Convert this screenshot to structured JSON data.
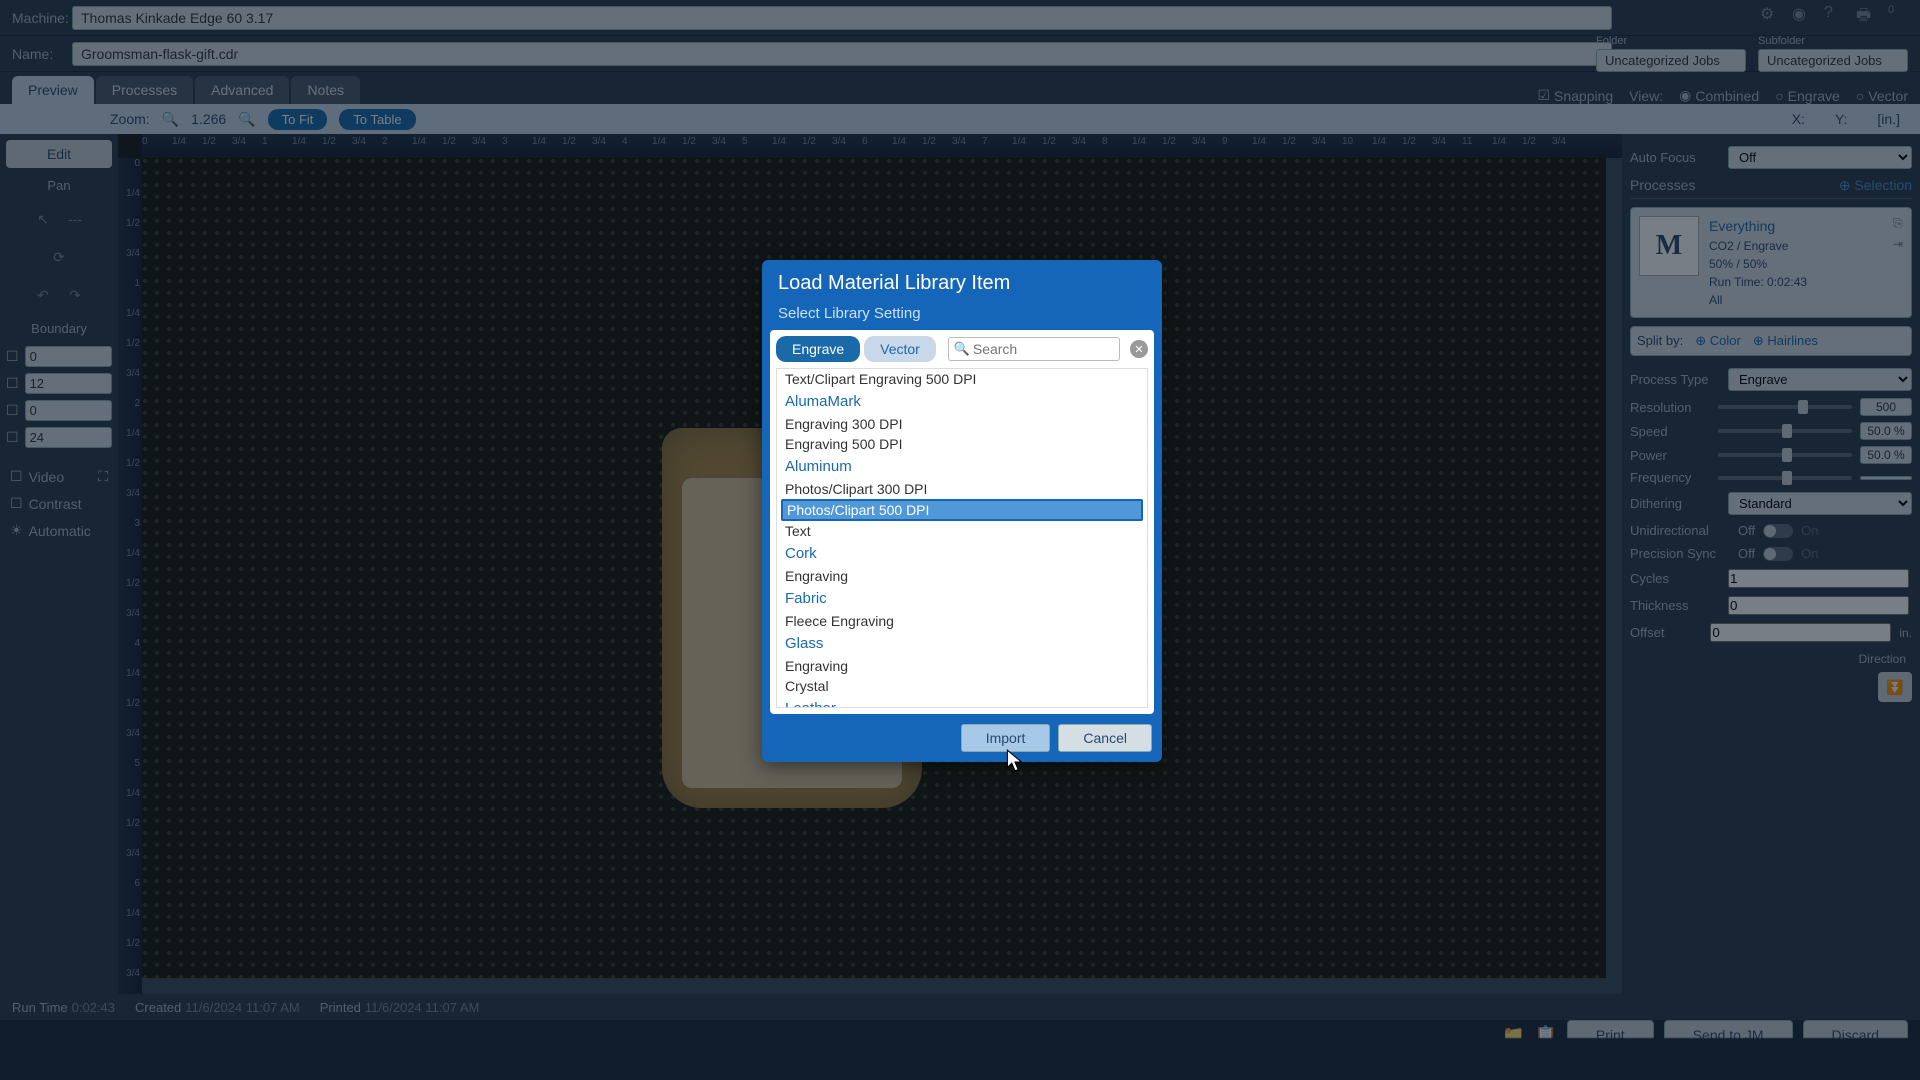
{
  "header": {
    "machine_label": "Machine:",
    "machine_value": "Thomas Kinkade Edge 60 3.17",
    "name_label": "Name:",
    "name_value": "Groomsman-flask-gift.cdr",
    "folder_label": "Folder",
    "subfolder_label": "Subfolder",
    "folder_value": "Uncategorized Jobs",
    "subfolder_value": "Uncategorized Jobs"
  },
  "tabs": {
    "preview": "Preview",
    "processes": "Processes",
    "advanced": "Advanced",
    "notes": "Notes"
  },
  "view_opts": {
    "snapping": "Snapping",
    "view": "View:",
    "combined": "Combined",
    "engrave": "Engrave",
    "vector": "Vector"
  },
  "zoom": {
    "label": "Zoom:",
    "value": "1.266",
    "tofit": "To Fit",
    "totable": "To Table",
    "x": "X:",
    "y": "Y:",
    "unit": "[in.]"
  },
  "left": {
    "edit": "Edit",
    "pan": "Pan",
    "boundary": "Boundary",
    "b0": "0",
    "b1": "12",
    "b2": "0",
    "b3": "24",
    "video": "Video",
    "contrast": "Contrast",
    "automatic": "Automatic"
  },
  "ruler_marks": [
    "0",
    "1/4",
    "1/2",
    "3/4",
    "1",
    "1/4",
    "1/2",
    "3/4",
    "2",
    "1/4",
    "1/2",
    "3/4",
    "3",
    "1/4",
    "1/2",
    "3/4",
    "4",
    "1/4",
    "1/2",
    "3/4",
    "5",
    "1/4",
    "1/2",
    "3/4",
    "6",
    "1/4",
    "1/2",
    "3/4",
    "7",
    "1/4",
    "1/2",
    "3/4",
    "8",
    "1/4",
    "1/2",
    "3/4",
    "9",
    "1/4",
    "1/2",
    "3/4",
    "10",
    "1/4",
    "1/2",
    "3/4",
    "11",
    "1/4",
    "1/2",
    "3/4"
  ],
  "right": {
    "autofocus": "Auto Focus",
    "autofocus_val": "Off",
    "processes": "Processes",
    "selection": "Selection",
    "card_title": "Everything",
    "card_type": "CO2 / Engrave",
    "card_power": "50% / 50%",
    "card_runtime": "Run Time: 0:02:43",
    "card_scope": "All",
    "splitby": "Split by:",
    "color": "Color",
    "hairlines": "Hairlines",
    "process_type": "Process Type",
    "process_type_val": "Engrave",
    "resolution": "Resolution",
    "resolution_val": "500",
    "speed": "Speed",
    "speed_val": "50.0",
    "pct": "%",
    "power": "Power",
    "power_val": "50.0",
    "frequency": "Frequency",
    "frequency_val": "",
    "dithering": "Dithering",
    "dithering_val": "Standard",
    "unidirectional": "Unidirectional",
    "off": "Off",
    "on": "On",
    "precision": "Precision Sync",
    "cycles": "Cycles",
    "cycles_val": "1",
    "thickness": "Thickness",
    "thickness_val": "0",
    "offset": "Offset",
    "offset_val": "0",
    "in": "in.",
    "direction": "Direction"
  },
  "status": {
    "runtime_lbl": "Run Time",
    "runtime": "0:02:43",
    "created_lbl": "Created",
    "created": "11/6/2024 11:07 AM",
    "printed_lbl": "Printed",
    "printed": "11/6/2024 11:07 AM"
  },
  "actions": {
    "print": "Print",
    "send": "Send to JM",
    "discard": "Discard"
  },
  "modal": {
    "title": "Load Material Library Item",
    "subtitle": "Select Library Setting",
    "tab_engrave": "Engrave",
    "tab_vector": "Vector",
    "search_placeholder": "Search",
    "import": "Import",
    "cancel": "Cancel",
    "items": [
      {
        "type": "item",
        "label": "Text/Clipart Engraving 500 DPI"
      },
      {
        "type": "cat",
        "label": "AlumaMark"
      },
      {
        "type": "item",
        "label": "Engraving 300 DPI"
      },
      {
        "type": "item",
        "label": "Engraving 500 DPI"
      },
      {
        "type": "cat",
        "label": "Aluminum"
      },
      {
        "type": "item",
        "label": "Photos/Clipart 300 DPI"
      },
      {
        "type": "item",
        "label": "Photos/Clipart 500 DPI",
        "selected": true
      },
      {
        "type": "item",
        "label": "Text"
      },
      {
        "type": "cat",
        "label": "Cork"
      },
      {
        "type": "item",
        "label": "Engraving"
      },
      {
        "type": "cat",
        "label": "Fabric"
      },
      {
        "type": "item",
        "label": "Fleece Engraving"
      },
      {
        "type": "cat",
        "label": "Glass"
      },
      {
        "type": "item",
        "label": "Engraving"
      },
      {
        "type": "item",
        "label": "Crystal"
      },
      {
        "type": "cat",
        "label": "Leather"
      }
    ]
  }
}
